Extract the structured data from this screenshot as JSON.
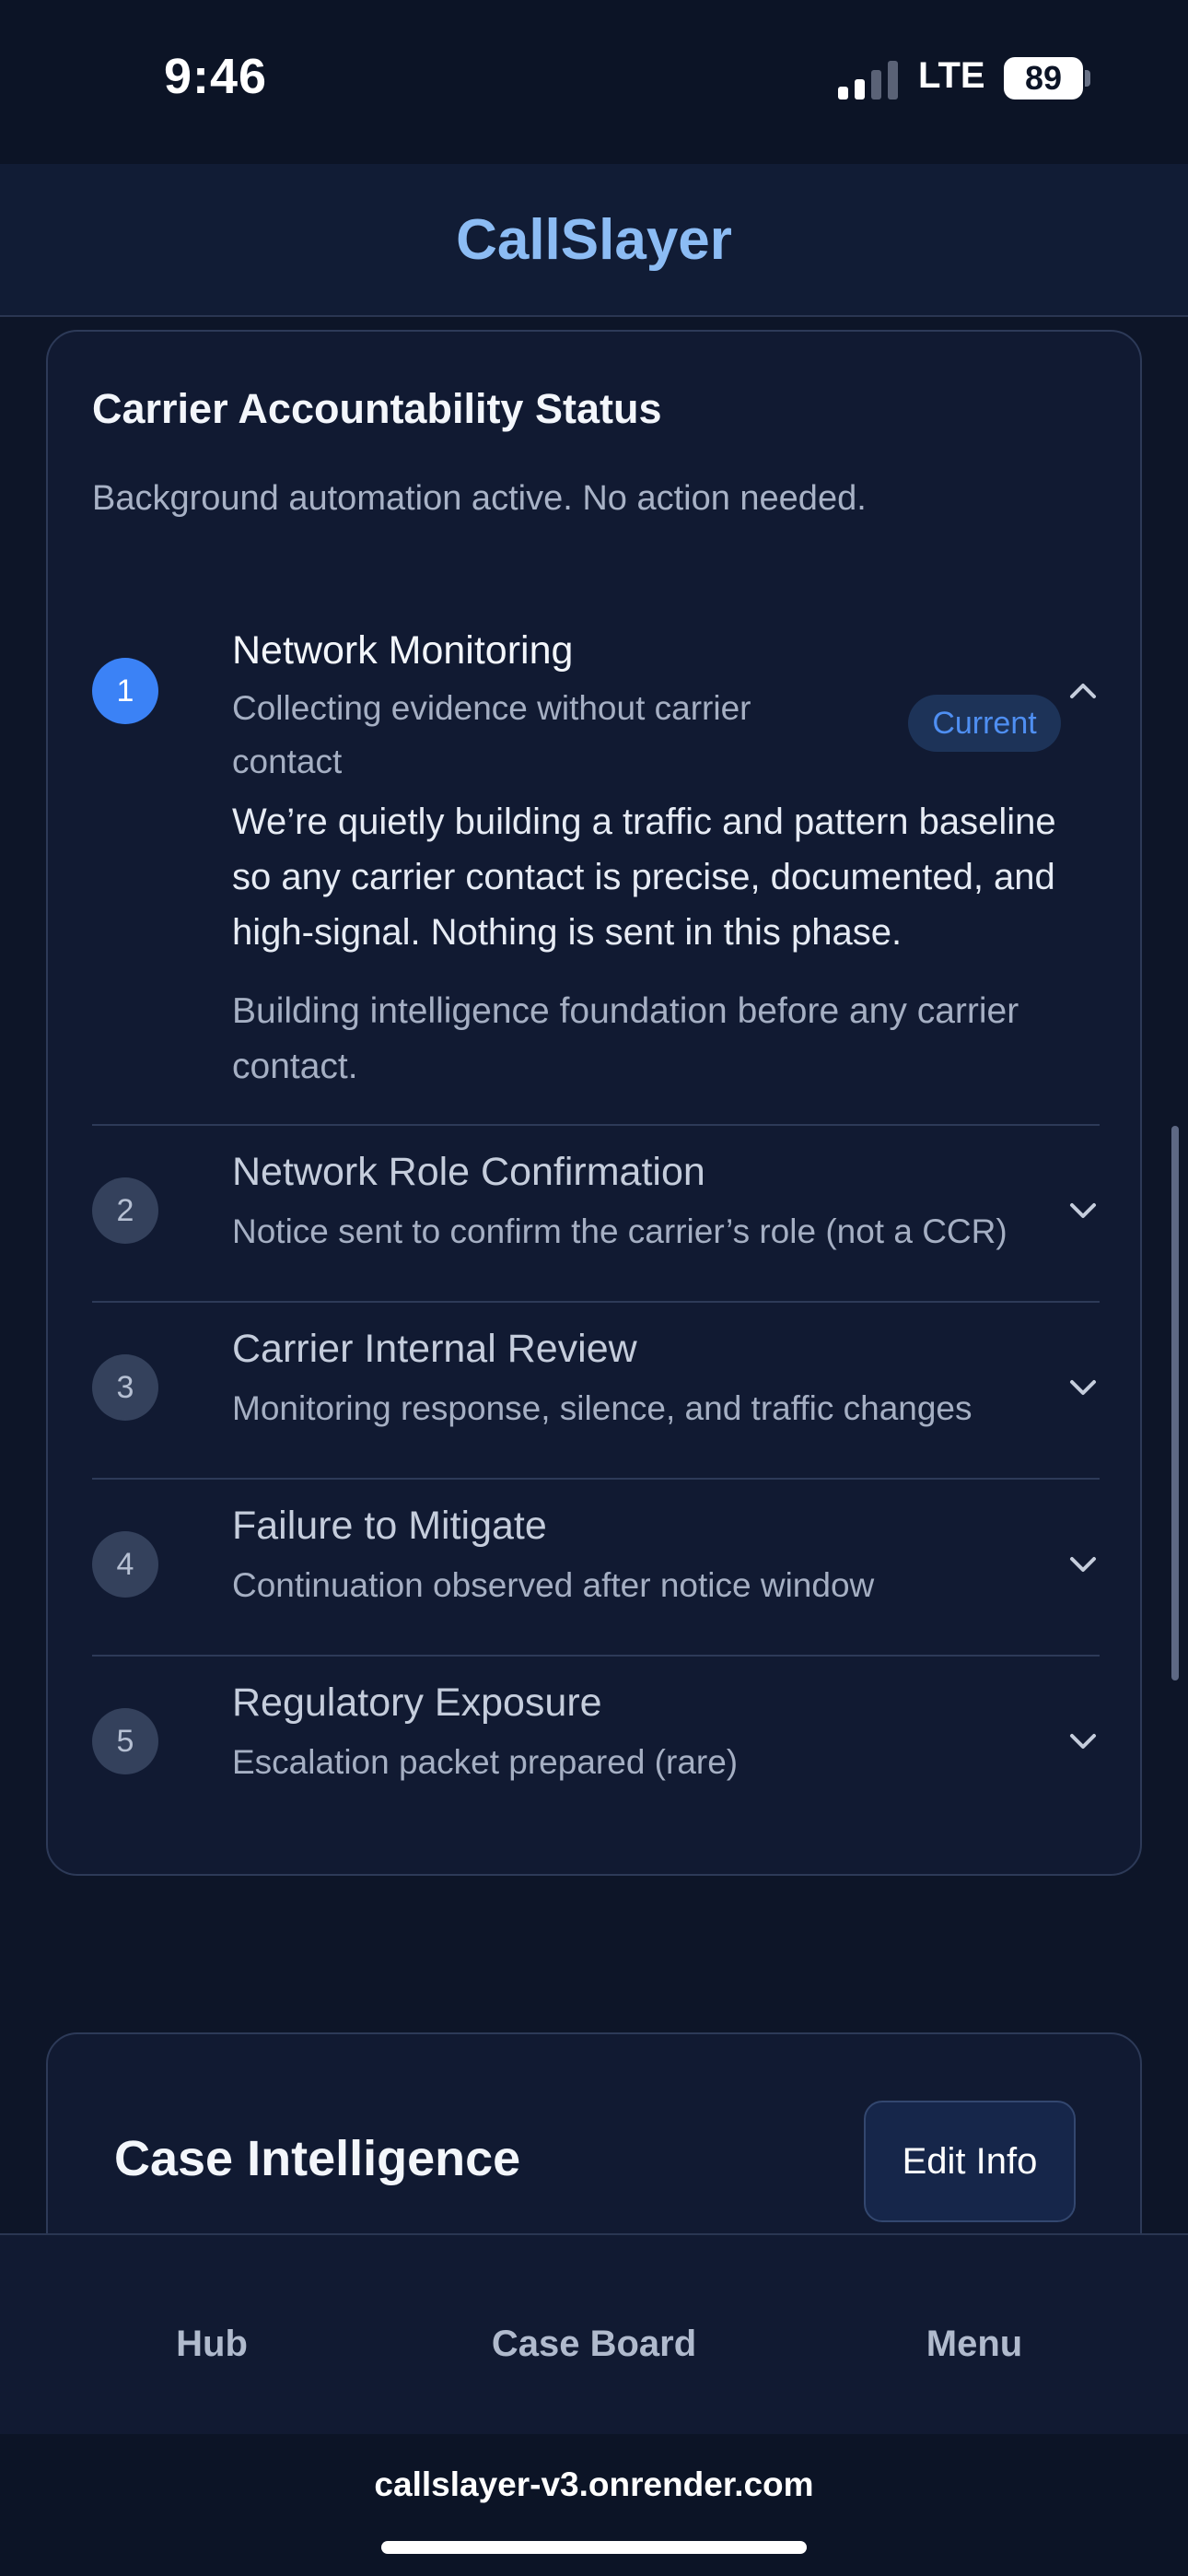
{
  "status_bar": {
    "time": "9:46",
    "network": "LTE",
    "battery": "89"
  },
  "header": {
    "title": "CallSlayer"
  },
  "carrier_status": {
    "title": "Carrier Accountability Status",
    "subtitle": "Background automation active. No action needed.",
    "steps": [
      {
        "number": "1",
        "title": "Network Monitoring",
        "description": "Collecting evidence without carrier contact",
        "badge": "Current",
        "expanded": true,
        "detail": "We’re quietly building a traffic and pattern baseline so any carrier contact is precise, documented, and high-signal. Nothing is sent in this phase.",
        "note": "Building intelligence foundation before any carrier contact."
      },
      {
        "number": "2",
        "title": "Network Role Confirmation",
        "description": "Notice sent to confirm the carrier’s role (not a CCR)"
      },
      {
        "number": "3",
        "title": "Carrier Internal Review",
        "description": "Monitoring response, silence, and traffic changes"
      },
      {
        "number": "4",
        "title": "Failure to Mitigate",
        "description": "Continuation observed after notice window"
      },
      {
        "number": "5",
        "title": "Regulatory Exposure",
        "description": "Escalation packet prepared (rare)"
      }
    ]
  },
  "case_intelligence": {
    "title": "Case Intelligence",
    "edit_label": "Edit Info"
  },
  "bottom_nav": {
    "items": [
      "Hub",
      "Case Board",
      "Menu"
    ]
  },
  "browser": {
    "url": "callslayer-v3.onrender.com"
  },
  "colors": {
    "accent": "#3b82f6",
    "brand_title": "#8cbcf4",
    "background": "#0d1528",
    "card": "#111a32"
  }
}
